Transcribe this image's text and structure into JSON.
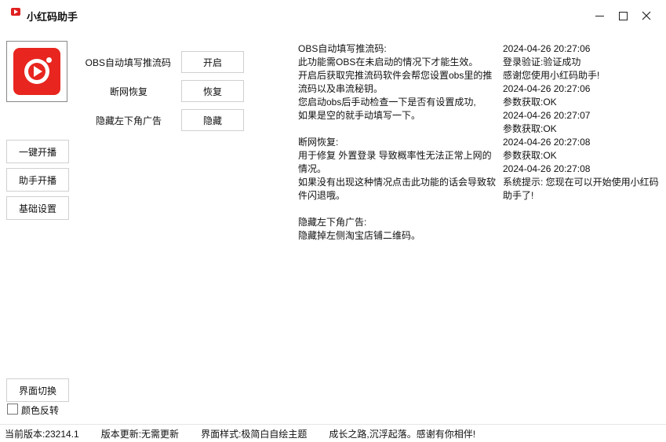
{
  "window": {
    "title": "小红码助手"
  },
  "sidebar": {
    "buttons": [
      {
        "id": "one-click-stream",
        "label": "一键开播"
      },
      {
        "id": "assistant-stream",
        "label": "助手开播"
      },
      {
        "id": "basic-settings",
        "label": "基础设置"
      }
    ],
    "switch_label": "界面切换",
    "invert_label": "颜色反转",
    "invert_checked": false
  },
  "options": [
    {
      "id": "obs-autofill",
      "label": "OBS自动填写推流码",
      "button": "开启"
    },
    {
      "id": "reconnect",
      "label": "断网恢复",
      "button": "恢复"
    },
    {
      "id": "hide-ad",
      "label": "隐藏左下角广告",
      "button": "隐藏"
    }
  ],
  "info_text": "OBS自动填写推流码:\n此功能需OBS在未启动的情况下才能生效。\n开启后获取完推流码软件会帮您设置obs里的推流码以及串流秘钥。\n您启动obs后手动检查一下是否有设置成功,\n如果是空的就手动填写一下。\n\n断网恢复:\n用于修复 外置登录 导致概率性无法正常上网的情况。\n如果没有出现这种情况点击此功能的话会导致软件闪退哦。\n\n隐藏左下角广告:\n隐藏掉左侧淘宝店铺二维码。",
  "log": [
    "2024-04-26 20:27:06",
    "登录验证:验证成功",
    "感谢您使用小红码助手!",
    "2024-04-26 20:27:06",
    "参数获取:OK",
    "2024-04-26 20:27:07",
    "参数获取:OK",
    "2024-04-26 20:27:08",
    "参数获取:OK",
    "2024-04-26 20:27:08",
    "系统提示: 您现在可以开始使用小红码助手了!"
  ],
  "status": {
    "version": "当前版本:23214.1",
    "update": "版本更新:无需更新",
    "theme": "界面样式:极简白自绘主题",
    "slogan": "成长之路,沉浮起落。感谢有你相伴!"
  }
}
